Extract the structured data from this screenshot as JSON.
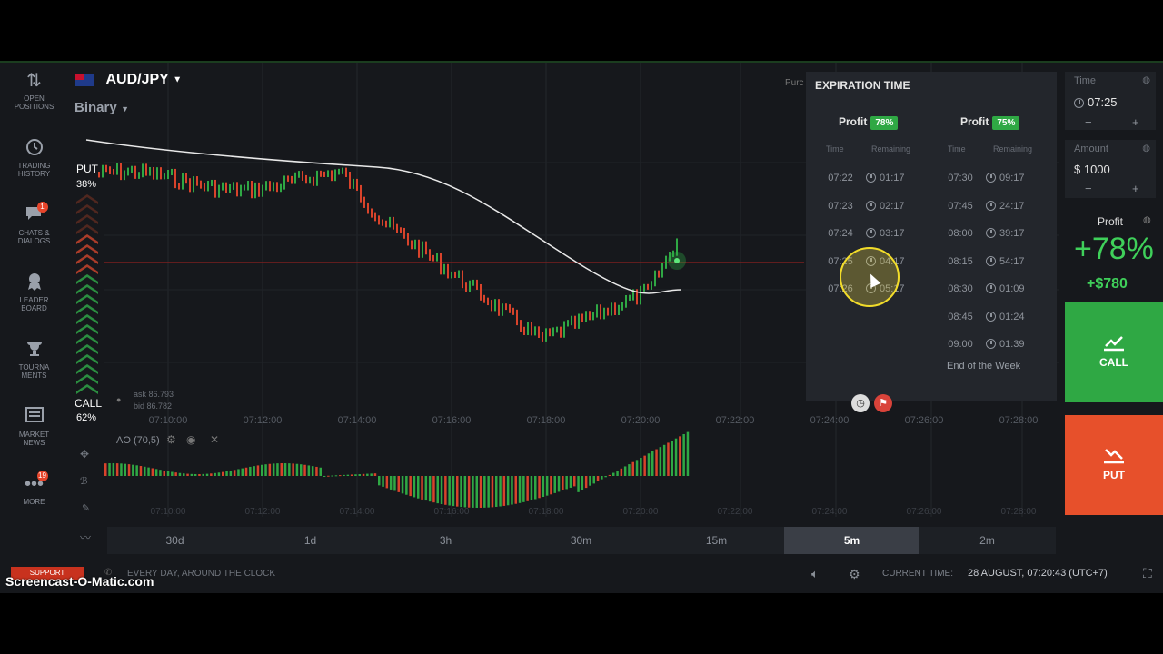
{
  "asset": {
    "name": "AUD/JPY",
    "mode": "Binary"
  },
  "sidebar": {
    "items": [
      {
        "icon": "arrows-updown-icon",
        "label1": "OPEN",
        "label2": "POSITIONS"
      },
      {
        "icon": "history-clock-icon",
        "label1": "TRADING",
        "label2": "HISTORY"
      },
      {
        "icon": "chat-icon",
        "label1": "CHATS &",
        "label2": "DIALOGS",
        "badge": "1"
      },
      {
        "icon": "leaderboard-icon",
        "label1": "LEADER",
        "label2": "BOARD"
      },
      {
        "icon": "trophy-icon",
        "label1": "TOURNA",
        "label2": "MENTS"
      },
      {
        "icon": "news-icon",
        "label1": "MARKET",
        "label2": "NEWS"
      },
      {
        "icon": "more-dots-icon",
        "label1": "MORE",
        "label2": "",
        "badge": "19"
      }
    ]
  },
  "sentiment": {
    "put_label": "PUT",
    "put_pct": "38%",
    "call_label": "CALL",
    "call_pct": "62%"
  },
  "chart": {
    "ask": "ask 86.793",
    "bid": "bid 86.782",
    "indicator": "AO (70,5)",
    "time_ticks": [
      "07:10:00",
      "07:12:00",
      "07:14:00",
      "07:16:00",
      "07:18:00",
      "07:20:00",
      "07:22:00",
      "07:24:00",
      "07:26:00",
      "07:28:00"
    ],
    "purchase_label": "Purc"
  },
  "timeframes": [
    "30d",
    "1d",
    "3h",
    "30m",
    "15m",
    "5m",
    "2m"
  ],
  "timeframe_active": "5m",
  "expiration": {
    "title": "EXPIRATION TIME",
    "profit_label": "Profit",
    "left": {
      "pct": "78%",
      "col_time": "Time",
      "col_remaining": "Remaining",
      "rows": [
        {
          "time": "07:22",
          "remaining": "01:17"
        },
        {
          "time": "07:23",
          "remaining": "02:17"
        },
        {
          "time": "07:24",
          "remaining": "03:17"
        },
        {
          "time": "07:25",
          "remaining": "04:17"
        },
        {
          "time": "07:26",
          "remaining": "05:17"
        }
      ]
    },
    "right": {
      "pct": "75%",
      "col_time": "Time",
      "col_remaining": "Remaining",
      "rows": [
        {
          "time": "07:30",
          "remaining": "09:17"
        },
        {
          "time": "07:45",
          "remaining": "24:17"
        },
        {
          "time": "08:00",
          "remaining": "39:17"
        },
        {
          "time": "08:15",
          "remaining": "54:17"
        },
        {
          "time": "08:30",
          "remaining": "01:09"
        },
        {
          "time": "08:45",
          "remaining": "01:24"
        },
        {
          "time": "09:00",
          "remaining": "01:39"
        }
      ],
      "end_of_week": "End of the Week"
    }
  },
  "trade": {
    "time_label": "Time",
    "time_value": "07:25",
    "amount_label": "Amount",
    "amount_value": "$ 1000",
    "profit_label": "Profit",
    "profit_pct": "+78%",
    "profit_amount": "+$780",
    "call_label": "CALL",
    "put_label": "PUT"
  },
  "footer": {
    "support": "SUPPORT",
    "tagline": "EVERY DAY, AROUND THE CLOCK",
    "current_time_label": "CURRENT TIME:",
    "current_time_value": "28 AUGUST, 07:20:43 (UTC+7)",
    "watermark": "Screencast-O-Matic.com"
  },
  "colors": {
    "call": "#2fa844",
    "put": "#e7502b",
    "accent_green": "#3fd05a",
    "panel": "#23262c"
  }
}
